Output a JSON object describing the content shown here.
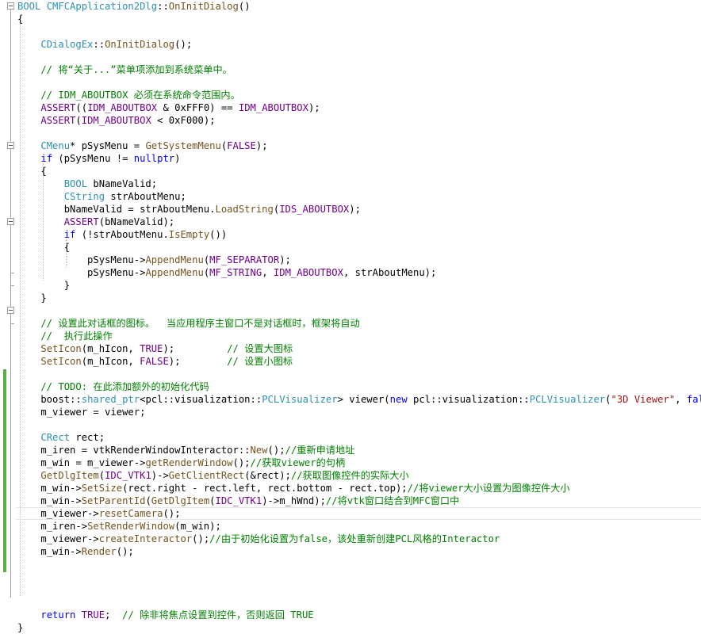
{
  "editor": {
    "lines": [
      [
        {
          "t": "BOOL ",
          "c": "t"
        },
        {
          "t": "CMFCApplication2Dlg",
          "c": "t"
        },
        {
          "t": "::",
          "c": "p"
        },
        {
          "t": "OnInitDialog",
          "c": "f"
        },
        {
          "t": "()",
          "c": "p"
        }
      ],
      [
        {
          "t": "{",
          "c": "p"
        }
      ],
      [],
      [
        {
          "t": "    ",
          "c": "p"
        },
        {
          "t": "CDialogEx",
          "c": "t"
        },
        {
          "t": "::",
          "c": "p"
        },
        {
          "t": "OnInitDialog",
          "c": "f"
        },
        {
          "t": "();",
          "c": "p"
        }
      ],
      [],
      [
        {
          "t": "    // 将“关于...”菜单项添加到系统菜单中。",
          "c": "c"
        }
      ],
      [],
      [
        {
          "t": "    // IDM_ABOUTBOX 必须在系统命令范围内。",
          "c": "c"
        }
      ],
      [
        {
          "t": "    ",
          "c": "p"
        },
        {
          "t": "ASSERT",
          "c": "m"
        },
        {
          "t": "((",
          "c": "p"
        },
        {
          "t": "IDM_ABOUTBOX",
          "c": "m"
        },
        {
          "t": " & 0xFFF0) == ",
          "c": "p"
        },
        {
          "t": "IDM_ABOUTBOX",
          "c": "m"
        },
        {
          "t": ");",
          "c": "p"
        }
      ],
      [
        {
          "t": "    ",
          "c": "p"
        },
        {
          "t": "ASSERT",
          "c": "m"
        },
        {
          "t": "(",
          "c": "p"
        },
        {
          "t": "IDM_ABOUTBOX",
          "c": "m"
        },
        {
          "t": " < 0xF000);",
          "c": "p"
        }
      ],
      [],
      [
        {
          "t": "    ",
          "c": "p"
        },
        {
          "t": "CMenu",
          "c": "t"
        },
        {
          "t": "* pSysMenu = ",
          "c": "p"
        },
        {
          "t": "GetSystemMenu",
          "c": "f"
        },
        {
          "t": "(",
          "c": "p"
        },
        {
          "t": "FALSE",
          "c": "m"
        },
        {
          "t": ");",
          "c": "p"
        }
      ],
      [
        {
          "t": "    ",
          "c": "p"
        },
        {
          "t": "if",
          "c": "k"
        },
        {
          "t": " (pSysMenu != ",
          "c": "p"
        },
        {
          "t": "nullptr",
          "c": "k"
        },
        {
          "t": ")",
          "c": "p"
        }
      ],
      [
        {
          "t": "    {",
          "c": "p"
        }
      ],
      [
        {
          "t": "        ",
          "c": "p"
        },
        {
          "t": "BOOL",
          "c": "t"
        },
        {
          "t": " bNameValid;",
          "c": "p"
        }
      ],
      [
        {
          "t": "        ",
          "c": "p"
        },
        {
          "t": "CString",
          "c": "t"
        },
        {
          "t": " strAboutMenu;",
          "c": "p"
        }
      ],
      [
        {
          "t": "        bNameValid = strAboutMenu.",
          "c": "p"
        },
        {
          "t": "LoadString",
          "c": "f"
        },
        {
          "t": "(",
          "c": "p"
        },
        {
          "t": "IDS_ABOUTBOX",
          "c": "m"
        },
        {
          "t": ");",
          "c": "p"
        }
      ],
      [
        {
          "t": "        ",
          "c": "p"
        },
        {
          "t": "ASSERT",
          "c": "m"
        },
        {
          "t": "(bNameValid);",
          "c": "p"
        }
      ],
      [
        {
          "t": "        ",
          "c": "p"
        },
        {
          "t": "if",
          "c": "k"
        },
        {
          "t": " (!strAboutMenu.",
          "c": "p"
        },
        {
          "t": "IsEmpty",
          "c": "f"
        },
        {
          "t": "())",
          "c": "p"
        }
      ],
      [
        {
          "t": "        {",
          "c": "p"
        }
      ],
      [
        {
          "t": "            pSysMenu->",
          "c": "p"
        },
        {
          "t": "AppendMenu",
          "c": "f"
        },
        {
          "t": "(",
          "c": "p"
        },
        {
          "t": "MF_SEPARATOR",
          "c": "m"
        },
        {
          "t": ");",
          "c": "p"
        }
      ],
      [
        {
          "t": "            pSysMenu->",
          "c": "p"
        },
        {
          "t": "AppendMenu",
          "c": "f"
        },
        {
          "t": "(",
          "c": "p"
        },
        {
          "t": "MF_STRING",
          "c": "m"
        },
        {
          "t": ", ",
          "c": "p"
        },
        {
          "t": "IDM_ABOUTBOX",
          "c": "m"
        },
        {
          "t": ", strAboutMenu);",
          "c": "p"
        }
      ],
      [
        {
          "t": "        }",
          "c": "p"
        }
      ],
      [
        {
          "t": "    }",
          "c": "p"
        }
      ],
      [],
      [
        {
          "t": "    // 设置此对话框的图标。  当应用程序主窗口不是对话框时，框架将自动",
          "c": "c"
        }
      ],
      [
        {
          "t": "    //  执行此操作",
          "c": "c"
        }
      ],
      [
        {
          "t": "    ",
          "c": "p"
        },
        {
          "t": "SetIcon",
          "c": "f"
        },
        {
          "t": "(m_hIcon, ",
          "c": "p"
        },
        {
          "t": "TRUE",
          "c": "m"
        },
        {
          "t": ");         ",
          "c": "p"
        },
        {
          "t": "// 设置大图标",
          "c": "c"
        }
      ],
      [
        {
          "t": "    ",
          "c": "p"
        },
        {
          "t": "SetIcon",
          "c": "f"
        },
        {
          "t": "(m_hIcon, ",
          "c": "p"
        },
        {
          "t": "FALSE",
          "c": "m"
        },
        {
          "t": ");        ",
          "c": "p"
        },
        {
          "t": "// 设置小图标",
          "c": "c"
        }
      ],
      [],
      [
        {
          "t": "    // TODO: 在此添加额外的初始化代码",
          "c": "c"
        }
      ],
      [
        {
          "t": "    boost",
          "c": "p"
        },
        {
          "t": "::",
          "c": "p"
        },
        {
          "t": "shared_ptr",
          "c": "t"
        },
        {
          "t": "<pcl::visualization::",
          "c": "p"
        },
        {
          "t": "PCLVisualizer",
          "c": "t"
        },
        {
          "t": "> viewer(",
          "c": "p"
        },
        {
          "t": "new",
          "c": "k"
        },
        {
          "t": " pcl::visualization::",
          "c": "p"
        },
        {
          "t": "PCLVisualizer",
          "c": "t"
        },
        {
          "t": "(",
          "c": "p"
        },
        {
          "t": "\"3D Viewer\"",
          "c": "s"
        },
        {
          "t": ", ",
          "c": "p"
        },
        {
          "t": "false",
          "c": "k"
        },
        {
          "t": "));",
          "c": "p"
        }
      ],
      [
        {
          "t": "    m_viewer = viewer;",
          "c": "p"
        }
      ],
      [],
      [
        {
          "t": "    ",
          "c": "p"
        },
        {
          "t": "CRect",
          "c": "t"
        },
        {
          "t": " rect;",
          "c": "p"
        }
      ],
      [
        {
          "t": "    m_iren = vtkRenderWindowInteractor::",
          "c": "p"
        },
        {
          "t": "New",
          "c": "f"
        },
        {
          "t": "();",
          "c": "p"
        },
        {
          "t": "//重新申请地址",
          "c": "c"
        }
      ],
      [
        {
          "t": "    m_win = m_viewer->",
          "c": "p"
        },
        {
          "t": "getRenderWindow",
          "c": "f"
        },
        {
          "t": "();",
          "c": "p"
        },
        {
          "t": "//获取viewer的句柄",
          "c": "c"
        }
      ],
      [
        {
          "t": "    ",
          "c": "p"
        },
        {
          "t": "GetDlgItem",
          "c": "f"
        },
        {
          "t": "(",
          "c": "p"
        },
        {
          "t": "IDC_VTK1",
          "c": "m"
        },
        {
          "t": ")->",
          "c": "p"
        },
        {
          "t": "GetClientRect",
          "c": "f"
        },
        {
          "t": "(&rect);",
          "c": "p"
        },
        {
          "t": "//获取图像控件的实际大小",
          "c": "c"
        }
      ],
      [
        {
          "t": "    m_win->",
          "c": "p"
        },
        {
          "t": "SetSize",
          "c": "f"
        },
        {
          "t": "(rect.right - rect.left, rect.bottom - rect.top);",
          "c": "p"
        },
        {
          "t": "//将viewer大小设置为图像控件大小",
          "c": "c"
        }
      ],
      [
        {
          "t": "    m_win->",
          "c": "p"
        },
        {
          "t": "SetParentId",
          "c": "f"
        },
        {
          "t": "(",
          "c": "p"
        },
        {
          "t": "GetDlgItem",
          "c": "f"
        },
        {
          "t": "(",
          "c": "p"
        },
        {
          "t": "IDC_VTK1",
          "c": "m"
        },
        {
          "t": ")->m_hWnd);",
          "c": "p"
        },
        {
          "t": "//将vtk窗口结合到MFC窗口中",
          "c": "c"
        }
      ],
      [
        {
          "t": "    m_viewer->",
          "c": "p"
        },
        {
          "t": "resetCamera",
          "c": "f"
        },
        {
          "t": "();",
          "c": "p"
        }
      ],
      [
        {
          "t": "    m_iren->",
          "c": "p"
        },
        {
          "t": "SetRenderWindow",
          "c": "f"
        },
        {
          "t": "(m_win);",
          "c": "p"
        }
      ],
      [
        {
          "t": "    m_viewer->",
          "c": "p"
        },
        {
          "t": "createInteractor",
          "c": "f"
        },
        {
          "t": "();",
          "c": "p"
        },
        {
          "t": "//由于初始化设置为false，该处重新创建PCL风格的Interactor",
          "c": "c"
        }
      ],
      [
        {
          "t": "    m_win->",
          "c": "p"
        },
        {
          "t": "Render",
          "c": "f"
        },
        {
          "t": "();",
          "c": "p"
        }
      ],
      [],
      [],
      [],
      [],
      [
        {
          "t": "    ",
          "c": "p"
        },
        {
          "t": "return",
          "c": "k"
        },
        {
          "t": " ",
          "c": "p"
        },
        {
          "t": "TRUE",
          "c": "m"
        },
        {
          "t": ";  ",
          "c": "p"
        },
        {
          "t": "// 除非将焦点设置到控件，否则返回 TRUE",
          "c": "c"
        }
      ],
      [
        {
          "t": "}",
          "c": "p"
        }
      ]
    ]
  },
  "colors": {
    "keyword": "#0000ff",
    "type": "#2b91af",
    "function": "#74531f",
    "macro": "#6f008a",
    "comment": "#008000",
    "string": "#a31515",
    "change_bar": "#57b046"
  },
  "icons": [
    "fold-collapse-icon"
  ]
}
